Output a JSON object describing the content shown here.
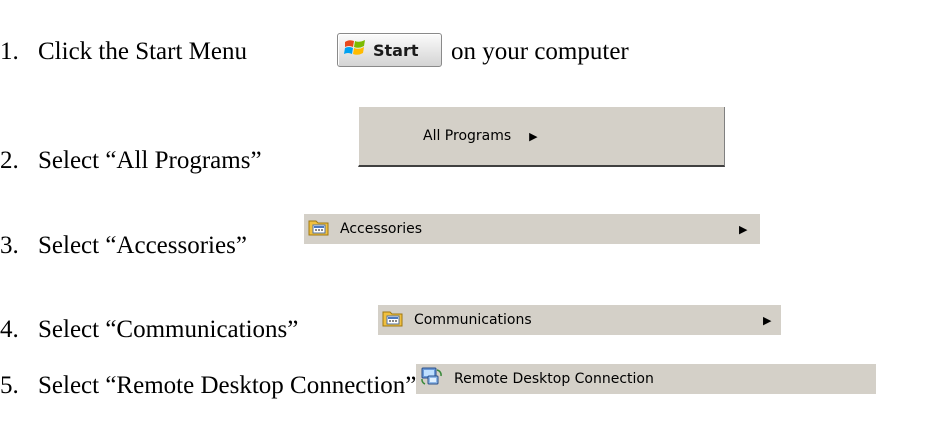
{
  "steps": [
    {
      "number": "1.",
      "text": "Click the Start Menu",
      "text_after": "on your computer"
    },
    {
      "number": "2.",
      "text": "Select “All Programs”"
    },
    {
      "number": "3.",
      "text": "Select “Accessories”"
    },
    {
      "number": "4.",
      "text": "Select “Communications”"
    },
    {
      "number": "5.",
      "text": "Select “Remote Desktop Connection”"
    }
  ],
  "ui": {
    "start_button": {
      "label": "Start",
      "icon": "windows-logo-icon"
    },
    "all_programs": {
      "label": "All Programs",
      "arrow": "▶"
    },
    "accessories": {
      "label": "Accessories",
      "icon": "program-folder-icon",
      "arrow": "▶"
    },
    "communications": {
      "label": "Communications",
      "icon": "program-folder-icon",
      "arrow": "▶"
    },
    "remote_desktop": {
      "label": "Remote Desktop Connection",
      "icon": "remote-desktop-icon"
    }
  },
  "colors": {
    "menu_background": "#d4d0c8",
    "text": "#000000",
    "start_logo_red": "#e8491d",
    "start_logo_green": "#7cbb00",
    "start_logo_blue": "#00a1f1",
    "start_logo_yellow": "#ffbb00"
  }
}
